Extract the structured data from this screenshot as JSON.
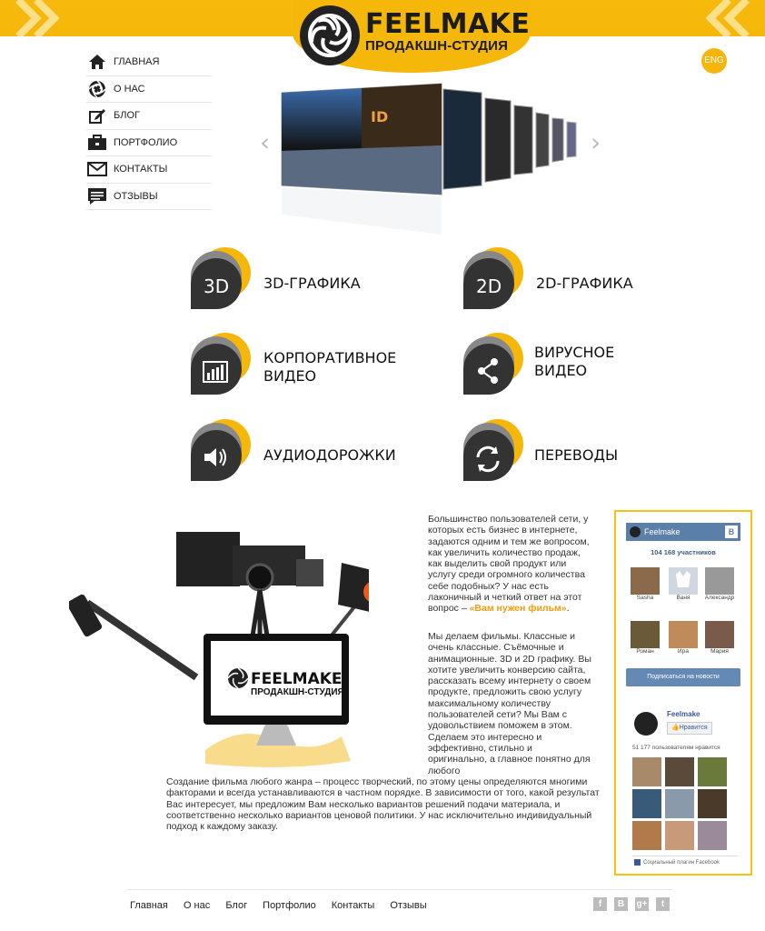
{
  "brand": {
    "name": "FEELMAKE",
    "tagline": "ПРОДАКШН-СТУДИЯ"
  },
  "lang_button": "ENG",
  "nav": [
    {
      "label": "ГЛАВНАЯ",
      "icon": "home-icon"
    },
    {
      "label": "О НАС",
      "icon": "aperture-icon"
    },
    {
      "label": "БЛОГ",
      "icon": "pen-icon"
    },
    {
      "label": "ПОРТФОЛИО",
      "icon": "briefcase-icon"
    },
    {
      "label": "КОНТАКТЫ",
      "icon": "envelope-icon"
    },
    {
      "label": "ОТЗЫВЫ",
      "icon": "comment-icon"
    }
  ],
  "slider": {
    "prev": "‹",
    "next": "›"
  },
  "services": [
    {
      "badge": "3D",
      "label": "3D-ГРАФИКА"
    },
    {
      "badge": "2D",
      "label": "2D-ГРАФИКА"
    },
    {
      "badge": "chart",
      "label": "КОРПОРАТИВНОЕ ВИДЕО"
    },
    {
      "badge": "share",
      "label": "ВИРУСНОЕ ВИДЕО"
    },
    {
      "badge": "audio",
      "label": "АУДИОДОРОЖКИ"
    },
    {
      "badge": "translate",
      "label": "ПЕРЕВОДЫ"
    }
  ],
  "intro": {
    "text": "Большинство пользователей сети, у которых есть бизнес в интернете, задаются одним и тем же вопросом, как увеличить количество продаж, как выделить свой продукт или услугу среди огромного количества себе подобных? У нас есть лаконичный и четкий ответ на этот вопрос –",
    "accent": "«Вам нужен фильм»",
    "end": "."
  },
  "para2": "Мы делаем фильмы. Классные и очень классные. Съёмочные и анимационные. 3D и 2D графику. Вы хотите увеличить конверсию сайта, рассказать всему интернету о своем продукте, предложить свою услугу максимальному количеству пользователей сети? Мы Вам с удовольствием поможем в этом. Сделаем это интересно и эффективно, стильно и оригинально, а главное понятно для любого",
  "para3": "Создание фильма любого жанра – процесс творческий, по этому цены определяются многими факторами и всегда устанавливаются в частном порядке. В зависимости от того, какой результат Вас интересует, мы предложим Вам несколько вариантов решений подачи материала, и соответственно несколько вариантов ценовой политики. У нас исключительно индивидуальный подход к каждому заказу.",
  "vk": {
    "title": "Feelmake",
    "members": "104 168 участников",
    "people": [
      "Sasha",
      "Ваня",
      "Александр",
      "Роман",
      "Ира",
      "Мария"
    ],
    "subscribe": "Подписаться на новости"
  },
  "fb": {
    "name": "Feelmake",
    "like": "Нравится",
    "count": "51 177 пользователям нравится",
    "plugin": "Социальный плагин Facebook"
  },
  "monitor": {
    "brand": "FEELMAKE",
    "tagline": "ПРОДАКШН-СТУДИЯ"
  },
  "footer": [
    "Главная",
    "О нас",
    "Блог",
    "Портфолио",
    "Контакты",
    "Отзывы"
  ],
  "social": [
    "f",
    "B",
    "g+",
    "t"
  ],
  "colors": {
    "accent": "#f5b70a",
    "dark": "#222222",
    "vk": "#5a7fa8"
  }
}
